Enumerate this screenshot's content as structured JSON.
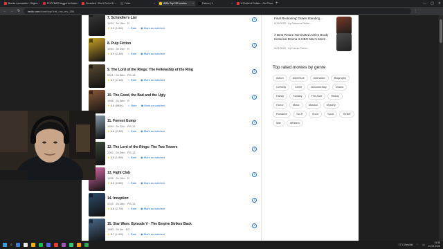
{
  "browser": {
    "tabs": [
      {
        "title": "Boruta Lsemadelo - Odgtoc",
        "color": "#e33b2e",
        "active": false
      },
      {
        "title": "FOOTBAR Nuggol for Mako",
        "color": "#d7263d",
        "active": false
      },
      {
        "title": "Smashed - Don't Pull of B",
        "color": "#e33b2e",
        "active": false
      },
      {
        "title": "Folex",
        "color": "#444",
        "active": false
      },
      {
        "title": "IMDb Top 250 movies",
        "color": "#f5c518",
        "active": true
      },
      {
        "title": "Fatsuo | X",
        "color": "#111",
        "active": false
      },
      {
        "title": "A Fistful of Dollars - Get There",
        "color": "#e33b2e",
        "active": false
      }
    ],
    "url_host": "imdb.com",
    "url_path": "/chart/top/?ref_=nv_mv_250",
    "window_controls": [
      "—",
      "▢",
      "✕"
    ]
  },
  "movies": [
    {
      "rank_title": "7. Schindler's List",
      "year": "1993",
      "length": "3h 15m",
      "cert": "R",
      "rating": "9.0",
      "votes": "(1.5M)",
      "rate": "Rate",
      "watch": "Mark as watched",
      "poster": "#3a3a3a"
    },
    {
      "rank_title": "8. Pulp Fiction",
      "year": "1994",
      "length": "2h 34m",
      "cert": "R",
      "rating": "8.9",
      "votes": "(2.3M)",
      "rate": "Rate",
      "watch": "Mark as watched",
      "poster": "#c9a227"
    },
    {
      "rank_title": "9. The Lord of the Rings: The Fellowship of the Ring",
      "year": "2001",
      "length": "2h 58m",
      "cert": "PG-13",
      "rating": "8.9",
      "votes": "(2.1M)",
      "rate": "Rate",
      "watch": "Mark as watched",
      "poster": "#5a4a32"
    },
    {
      "rank_title": "10. The Good, the Bad and the Ugly",
      "year": "1966",
      "length": "2h 58m",
      "cert": "R",
      "rating": "8.8",
      "votes": "(850K)",
      "rate": "Rate",
      "watch": "Mark as watched",
      "poster": "#8a5a3a"
    },
    {
      "rank_title": "11. Forrest Gump",
      "year": "1994",
      "length": "2h 22m",
      "cert": "PG-13",
      "rating": "8.8",
      "votes": "(2.3M)",
      "rate": "Rate",
      "watch": "Mark as watched",
      "poster": "#8fa6b5"
    },
    {
      "rank_title": "12. The Lord of the Rings: The Two Towers",
      "year": "2002",
      "length": "2h 59m",
      "cert": "PG-13",
      "rating": "8.8",
      "votes": "(1.8M)",
      "rate": "Rate",
      "watch": "Mark as watched",
      "poster": "#3e4a3a"
    },
    {
      "rank_title": "13. Fight Club",
      "year": "1999",
      "length": "2h 19m",
      "cert": "R",
      "rating": "8.8",
      "votes": "(2.5M)",
      "rate": "Rate",
      "watch": "Mark as watched",
      "poster": "#d86aa8"
    },
    {
      "rank_title": "14. Inception",
      "year": "2010",
      "length": "2h 28m",
      "cert": "PG-13",
      "rating": "8.8",
      "votes": "(2.7M)",
      "rate": "Rate",
      "watch": "Mark as watched",
      "poster": "#2d4a6a"
    },
    {
      "rank_title": "15. Star Wars: Episode V - The Empire Strikes Back",
      "year": "1980",
      "length": "2h 4m",
      "cert": "PG",
      "rating": "8.7",
      "votes": "(1.4M)",
      "rate": "Rate",
      "watch": "Mark as watched",
      "poster": "#4a6a8a"
    }
  ],
  "news": [
    {
      "title": "Final Reckoning' Draws Standing...",
      "meta": "5/15/2025 · by Rebecca Rubin...",
      "thumb": "#7a3a2a"
    },
    {
      "title": "A Best Picture Nominated Adrien Brody Historical Drama Is HBO Max's Most...",
      "meta": "5/21/2025 · by Kieran Fisher...",
      "thumb": "#4a4a4a"
    }
  ],
  "genres": {
    "heading": "Top rated movies by genre",
    "chips": [
      "Action",
      "Adventure",
      "Animation",
      "Biography",
      "Comedy",
      "Crime",
      "Documentary",
      "Drama",
      "Family",
      "Fantasy",
      "Film-Noir",
      "History",
      "Horror",
      "Music",
      "Musical",
      "Mystery",
      "Romance",
      "Sci-Fi",
      "Short",
      "Sport",
      "Thriller",
      "War",
      "Western"
    ]
  },
  "taskbar": {
    "icons": [
      "#3a7bd5",
      "#e8e8e8",
      "#f0b400",
      "#1db954",
      "#5865f2",
      "#e33b2e",
      "#9b59b6",
      "#2ecc71",
      "#ff9900",
      "#34a853"
    ],
    "weather": "17°C Bewölkt",
    "time": "13:38",
    "date": "21.05.2025"
  }
}
